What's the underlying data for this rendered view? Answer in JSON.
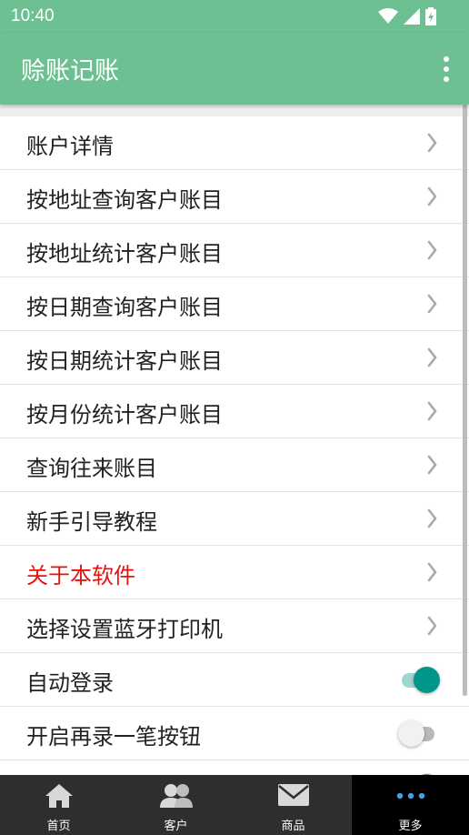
{
  "status_bar": {
    "time": "10:40"
  },
  "app_bar": {
    "title": "赊账记账"
  },
  "menu": [
    {
      "label": "账户详情",
      "type": "link"
    },
    {
      "label": "按地址查询客户账目",
      "type": "link"
    },
    {
      "label": "按地址统计客户账目",
      "type": "link"
    },
    {
      "label": "按日期查询客户账目",
      "type": "link"
    },
    {
      "label": "按日期统计客户账目",
      "type": "link"
    },
    {
      "label": "按月份统计客户账目",
      "type": "link"
    },
    {
      "label": "查询往来账目",
      "type": "link"
    },
    {
      "label": "新手引导教程",
      "type": "link"
    },
    {
      "label": "关于本软件",
      "type": "link",
      "color": "#e8120c"
    },
    {
      "label": "选择设置蓝牙打印机",
      "type": "link"
    },
    {
      "label": "自动登录",
      "type": "toggle",
      "on": true
    },
    {
      "label": "开启再录一笔按钮",
      "type": "toggle",
      "on": false
    },
    {
      "label": "",
      "type": "toggle",
      "on": true
    }
  ],
  "bottom_nav": [
    {
      "label": "首页",
      "icon": "home-icon",
      "active": false
    },
    {
      "label": "客户",
      "icon": "customers-icon",
      "active": false
    },
    {
      "label": "商品",
      "icon": "mail-icon",
      "active": false
    },
    {
      "label": "更多",
      "icon": "more-dots-icon",
      "active": true
    }
  ],
  "colors": {
    "primary": "#6cc092",
    "toggle_on": "#00978a",
    "highlight_text": "#e8120c",
    "nav_bg": "#2e2e2e"
  }
}
